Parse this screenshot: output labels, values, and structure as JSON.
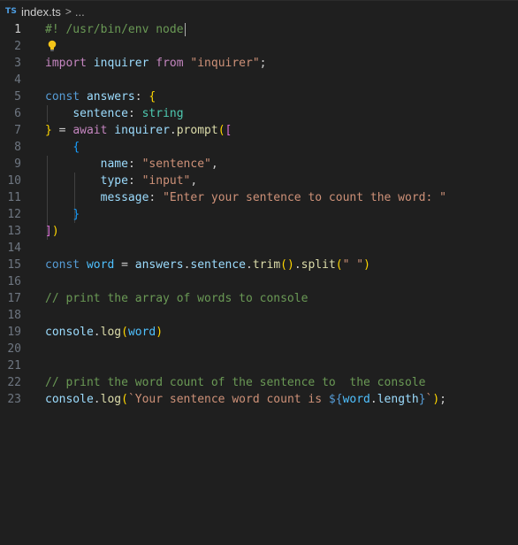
{
  "breadcrumb": {
    "language_badge": "TS",
    "file": "index.ts",
    "separator": ">",
    "ellipsis": "..."
  },
  "editor": {
    "active_line": 1,
    "lightbulb_line": 2,
    "lines": [
      {
        "n": "1",
        "tokens": [
          {
            "t": "#! /usr/bin/env node",
            "c": "comment"
          }
        ],
        "cursor": true
      },
      {
        "n": "2",
        "tokens": []
      },
      {
        "n": "3",
        "tokens": [
          {
            "t": "import",
            "c": "control"
          },
          {
            "t": " ",
            "c": "punct"
          },
          {
            "t": "inquirer",
            "c": "var"
          },
          {
            "t": " ",
            "c": "punct"
          },
          {
            "t": "from",
            "c": "control"
          },
          {
            "t": " ",
            "c": "punct"
          },
          {
            "t": "\"inquirer\"",
            "c": "string"
          },
          {
            "t": ";",
            "c": "punct"
          }
        ]
      },
      {
        "n": "4",
        "tokens": []
      },
      {
        "n": "5",
        "tokens": [
          {
            "t": "const",
            "c": "keyword"
          },
          {
            "t": " ",
            "c": "punct"
          },
          {
            "t": "answers",
            "c": "var"
          },
          {
            "t": ": ",
            "c": "punct"
          },
          {
            "t": "{",
            "c": "b1"
          }
        ]
      },
      {
        "n": "6",
        "tokens": [
          {
            "t": "    ",
            "c": "punct"
          },
          {
            "t": "sentence",
            "c": "var"
          },
          {
            "t": ": ",
            "c": "punct"
          },
          {
            "t": "string",
            "c": "type"
          }
        ]
      },
      {
        "n": "7",
        "tokens": [
          {
            "t": "}",
            "c": "b1"
          },
          {
            "t": " = ",
            "c": "punct"
          },
          {
            "t": "await",
            "c": "control"
          },
          {
            "t": " ",
            "c": "punct"
          },
          {
            "t": "inquirer",
            "c": "var"
          },
          {
            "t": ".",
            "c": "punct"
          },
          {
            "t": "prompt",
            "c": "func"
          },
          {
            "t": "(",
            "c": "b1"
          },
          {
            "t": "[",
            "c": "b2"
          }
        ]
      },
      {
        "n": "8",
        "tokens": [
          {
            "t": "    ",
            "c": "punct"
          },
          {
            "t": "{",
            "c": "b3"
          }
        ]
      },
      {
        "n": "9",
        "tokens": [
          {
            "t": "        ",
            "c": "punct"
          },
          {
            "t": "name",
            "c": "var"
          },
          {
            "t": ": ",
            "c": "punct"
          },
          {
            "t": "\"sentence\"",
            "c": "string"
          },
          {
            "t": ",",
            "c": "punct"
          }
        ]
      },
      {
        "n": "10",
        "tokens": [
          {
            "t": "        ",
            "c": "punct"
          },
          {
            "t": "type",
            "c": "var"
          },
          {
            "t": ": ",
            "c": "punct"
          },
          {
            "t": "\"input\"",
            "c": "string"
          },
          {
            "t": ",",
            "c": "punct"
          }
        ]
      },
      {
        "n": "11",
        "tokens": [
          {
            "t": "        ",
            "c": "punct"
          },
          {
            "t": "message",
            "c": "var"
          },
          {
            "t": ": ",
            "c": "punct"
          },
          {
            "t": "\"Enter your sentence to count the word: \"",
            "c": "string"
          }
        ]
      },
      {
        "n": "12",
        "tokens": [
          {
            "t": "    ",
            "c": "punct"
          },
          {
            "t": "}",
            "c": "b3"
          }
        ]
      },
      {
        "n": "13",
        "tokens": [
          {
            "t": "]",
            "c": "b2"
          },
          {
            "t": ")",
            "c": "b1"
          }
        ]
      },
      {
        "n": "14",
        "tokens": []
      },
      {
        "n": "15",
        "tokens": [
          {
            "t": "const",
            "c": "keyword"
          },
          {
            "t": " ",
            "c": "punct"
          },
          {
            "t": "word",
            "c": "const"
          },
          {
            "t": " = ",
            "c": "punct"
          },
          {
            "t": "answers",
            "c": "var"
          },
          {
            "t": ".",
            "c": "punct"
          },
          {
            "t": "sentence",
            "c": "var"
          },
          {
            "t": ".",
            "c": "punct"
          },
          {
            "t": "trim",
            "c": "func"
          },
          {
            "t": "()",
            "c": "b1"
          },
          {
            "t": ".",
            "c": "punct"
          },
          {
            "t": "split",
            "c": "func"
          },
          {
            "t": "(",
            "c": "b1"
          },
          {
            "t": "\" \"",
            "c": "string"
          },
          {
            "t": ")",
            "c": "b1"
          }
        ]
      },
      {
        "n": "16",
        "tokens": []
      },
      {
        "n": "17",
        "tokens": [
          {
            "t": "// print the array of words to console",
            "c": "comment"
          }
        ]
      },
      {
        "n": "18",
        "tokens": []
      },
      {
        "n": "19",
        "tokens": [
          {
            "t": "console",
            "c": "var"
          },
          {
            "t": ".",
            "c": "punct"
          },
          {
            "t": "log",
            "c": "func"
          },
          {
            "t": "(",
            "c": "b1"
          },
          {
            "t": "word",
            "c": "const"
          },
          {
            "t": ")",
            "c": "b1"
          }
        ]
      },
      {
        "n": "20",
        "tokens": []
      },
      {
        "n": "21",
        "tokens": []
      },
      {
        "n": "22",
        "tokens": [
          {
            "t": "// print the word count of the sentence to  the console",
            "c": "comment"
          }
        ]
      },
      {
        "n": "23",
        "tokens": [
          {
            "t": "console",
            "c": "var"
          },
          {
            "t": ".",
            "c": "punct"
          },
          {
            "t": "log",
            "c": "func"
          },
          {
            "t": "(",
            "c": "b1"
          },
          {
            "t": "`Your sentence word count is ",
            "c": "string"
          },
          {
            "t": "${",
            "c": "keyword"
          },
          {
            "t": "word",
            "c": "const"
          },
          {
            "t": ".",
            "c": "punct"
          },
          {
            "t": "length",
            "c": "var"
          },
          {
            "t": "}",
            "c": "keyword"
          },
          {
            "t": "`",
            "c": "string"
          },
          {
            "t": ")",
            "c": "b1"
          },
          {
            "t": ";",
            "c": "punct"
          }
        ]
      }
    ]
  },
  "icons": {
    "lightbulb": "lightbulb-icon",
    "language": "typescript-file-icon"
  },
  "colors": {
    "background": "#1f1f1f",
    "comment": "#6a9955",
    "keyword": "#569cd6",
    "control": "#c586c0",
    "string": "#ce9178",
    "function": "#dcdcaa",
    "variable": "#9cdcfe",
    "type": "#4ec9b0",
    "lightbulb": "#f5c518"
  }
}
